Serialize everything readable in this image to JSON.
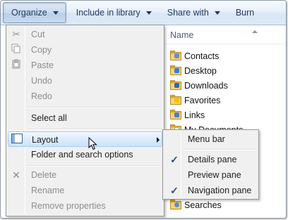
{
  "toolbar": {
    "organize": "Organize",
    "include_in_library": "Include in library",
    "share_with": "Share with",
    "burn": "Burn"
  },
  "file_list": {
    "column_name": "Name",
    "items": [
      {
        "label": "Contacts",
        "icon": "contacts-folder-icon"
      },
      {
        "label": "Desktop",
        "icon": "desktop-folder-icon"
      },
      {
        "label": "Downloads",
        "icon": "downloads-folder-icon"
      },
      {
        "label": "Favorites",
        "icon": "favorites-folder-icon"
      },
      {
        "label": "Links",
        "icon": "links-folder-icon"
      },
      {
        "label": "My Documents",
        "icon": "documents-folder-icon"
      },
      {
        "label": "Searches",
        "icon": "searches-folder-icon"
      }
    ]
  },
  "organize_menu": {
    "items": [
      {
        "label": "Cut",
        "enabled": false,
        "icon": "scissors-icon"
      },
      {
        "label": "Copy",
        "enabled": false,
        "icon": "copy-icon"
      },
      {
        "label": "Paste",
        "enabled": false,
        "icon": "paste-icon"
      },
      {
        "label": "Undo",
        "enabled": false
      },
      {
        "label": "Redo",
        "enabled": false
      },
      {
        "label": "Select all",
        "enabled": true
      },
      {
        "label": "Layout",
        "enabled": true,
        "highlighted": true,
        "has_submenu": true,
        "icon": "layout-icon"
      },
      {
        "label": "Folder and search options",
        "enabled": true
      },
      {
        "label": "Delete",
        "enabled": false,
        "icon": "delete-x-icon"
      },
      {
        "label": "Rename",
        "enabled": false
      },
      {
        "label": "Remove properties",
        "enabled": false
      }
    ]
  },
  "layout_submenu": {
    "items": [
      {
        "label": "Menu bar",
        "checked": false
      },
      {
        "label": "Details pane",
        "checked": true
      },
      {
        "label": "Preview pane",
        "checked": false
      },
      {
        "label": "Navigation pane",
        "checked": true
      }
    ]
  },
  "colors": {
    "toolbar_text": "#1e395b",
    "menu_bg": "#f0f0f0",
    "highlight_border": "#a7cdf0",
    "disabled_text": "#8d8d8d",
    "check": "#2b4a7a"
  }
}
